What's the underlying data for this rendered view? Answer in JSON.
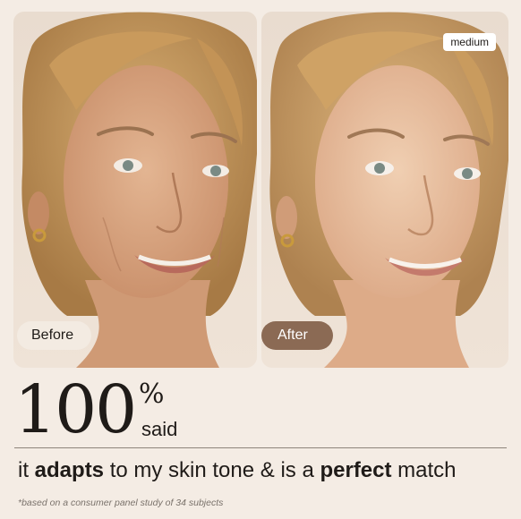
{
  "photos": {
    "before": {
      "label": "Before"
    },
    "after": {
      "label": "After",
      "shade_badge": "medium"
    }
  },
  "stat": {
    "number": "100",
    "percent": "%",
    "said": "said"
  },
  "statement": {
    "part1": "it ",
    "bold1": "adapts",
    "part2": " to my skin tone & is a ",
    "bold2": "perfect",
    "part3": " match"
  },
  "footnote": "*based on a consumer panel study of 34 subjects",
  "colors": {
    "background": "#f4ece4",
    "after_pill": "#8b6a54",
    "before_pill": "#f3ebe2"
  }
}
